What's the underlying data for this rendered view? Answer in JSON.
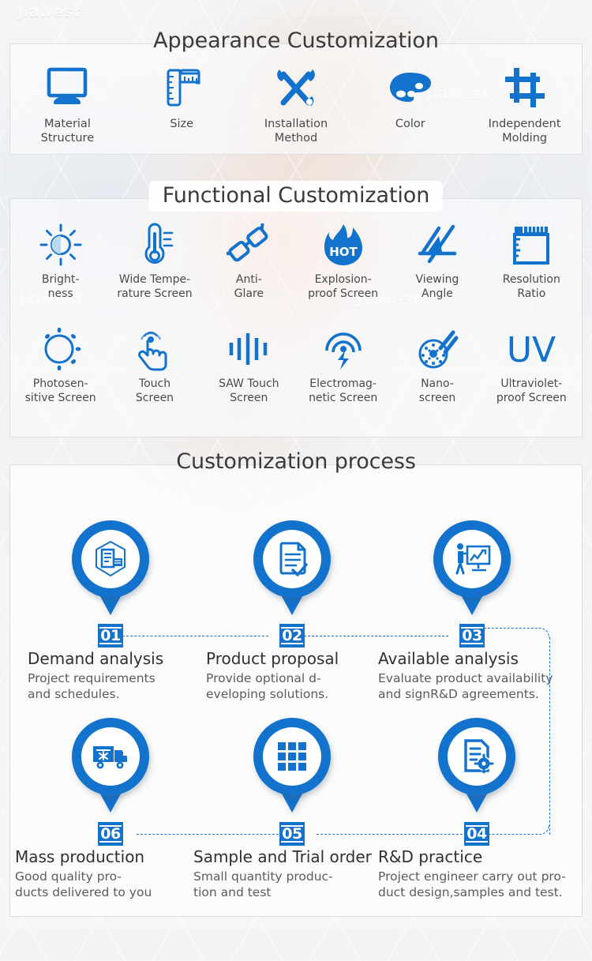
{
  "watermark": {
    "text": "Jiawest"
  },
  "theme": {
    "accent": "#1272cc",
    "title_color": "#3a3a3a",
    "label_color": "#4a4a4a",
    "card_border": "#dcdde0"
  },
  "sections": {
    "appearance": {
      "title": "Appearance Customization",
      "items": [
        {
          "icon": "monitor-icon",
          "label": "Material\nStructure",
          "line1": "Material",
          "line2": "Structure"
        },
        {
          "icon": "ruler-icon",
          "label": "Size",
          "line1": "Size",
          "line2": ""
        },
        {
          "icon": "wrench-screwdriver-icon",
          "label": "Installation Method",
          "line1": "Installation",
          "line2": "Method"
        },
        {
          "icon": "palette-icon",
          "label": "Color",
          "line1": "Color",
          "line2": ""
        },
        {
          "icon": "crop-mold-icon",
          "label": "Independent Molding",
          "line1": "Independent",
          "line2": "Molding"
        }
      ]
    },
    "functional": {
      "title": "Functional Customization",
      "row1": [
        {
          "icon": "sun-brightness-icon",
          "line1": "Bright-",
          "line2": "ness"
        },
        {
          "icon": "thermometer-icon",
          "line1": "Wide Tempe-",
          "line2": "rature Screen"
        },
        {
          "icon": "anti-glare-glasses-icon",
          "line1": "Anti-",
          "line2": "Glare"
        },
        {
          "icon": "flame-hot-icon",
          "line1": "Explosion-",
          "line2": "proof Screen"
        },
        {
          "icon": "viewing-angle-icon",
          "line1": "Viewing",
          "line2": "Angle"
        },
        {
          "icon": "resolution-ruler-icon",
          "line1": "Resolution",
          "line2": "Ratio"
        }
      ],
      "row2": [
        {
          "icon": "photosensitive-sun-moon-icon",
          "line1": "Photosen-",
          "line2": "sitive Screen"
        },
        {
          "icon": "touch-hand-icon",
          "line1": "Touch",
          "line2": "Screen"
        },
        {
          "icon": "saw-wave-icon",
          "line1": "SAW Touch",
          "line2": "Screen"
        },
        {
          "icon": "electromagnetic-icon",
          "line1": "Electromag-",
          "line2": "netic Screen"
        },
        {
          "icon": "nano-screen-icon",
          "line1": "Nano-",
          "line2": "screen"
        },
        {
          "icon": "uv-text-icon",
          "line1": "Ultraviolet-",
          "line2": "proof Screen"
        }
      ]
    },
    "process": {
      "title": "Customization process",
      "steps": [
        {
          "number": "01",
          "icon": "document-certificate-icon",
          "title": "Demand analysis",
          "desc_line1": "Project requirements",
          "desc_line2": "and schedules."
        },
        {
          "number": "02",
          "icon": "checklist-clipboard-icon",
          "title": "Product proposal",
          "desc_line1": "Provide optional d-",
          "desc_line2": "eveloping solutions."
        },
        {
          "number": "03",
          "icon": "presentation-chart-icon",
          "title": "Available analysis",
          "desc_line1": "Evaluate product availability",
          "desc_line2": "and signR&D agreements."
        },
        {
          "number": "04",
          "icon": "document-gear-icon",
          "title": "R&D practice",
          "desc_line1": "Project engineer carry out pro-",
          "desc_line2": "duct design,samples and test."
        },
        {
          "number": "05",
          "icon": "grid-squares-icon",
          "title": "Sample and Trial order",
          "desc_line1": "Small quantity produc-",
          "desc_line2": "tion and test"
        },
        {
          "number": "06",
          "icon": "delivery-truck-icon",
          "title": "Mass production",
          "desc_line1": "Good quality pro-",
          "desc_line2": "ducts delivered to you"
        }
      ]
    }
  }
}
